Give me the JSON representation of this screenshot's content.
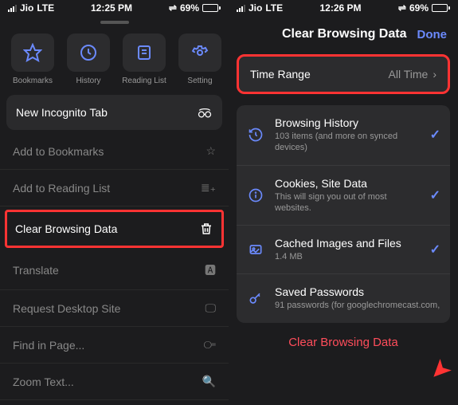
{
  "left": {
    "status": {
      "carrier": "Jio",
      "net": "LTE",
      "time": "12:25 PM",
      "battery": "69%"
    },
    "quick": {
      "bookmarks": "Bookmarks",
      "history": "History",
      "readinglist": "Reading List",
      "settings": "Setting"
    },
    "menu": {
      "incognito": "New Incognito Tab",
      "addbookmarks": "Add to Bookmarks",
      "addreadinglist": "Add to Reading List",
      "clearbrowsing": "Clear Browsing Data",
      "translate": "Translate",
      "desktopsite": "Request Desktop Site",
      "findinpage": "Find in Page...",
      "zoomtext": "Zoom Text..."
    }
  },
  "right": {
    "status": {
      "carrier": "Jio",
      "net": "LTE",
      "time": "12:26 PM",
      "battery": "69%"
    },
    "header": {
      "title": "Clear Browsing Data",
      "done": "Done"
    },
    "timerange": {
      "label": "Time Range",
      "value": "All Time"
    },
    "items": {
      "history": {
        "title": "Browsing History",
        "sub": "103 items (and more on synced devices)"
      },
      "cookies": {
        "title": "Cookies, Site Data",
        "sub": "This will sign you out of most websites."
      },
      "cache": {
        "title": "Cached Images and Files",
        "sub": "1.4 MB"
      },
      "passwords": {
        "title": "Saved Passwords",
        "sub": "91 passwords (for googlechromecast.com,"
      }
    },
    "clearbtn": "Clear Browsing Data"
  }
}
